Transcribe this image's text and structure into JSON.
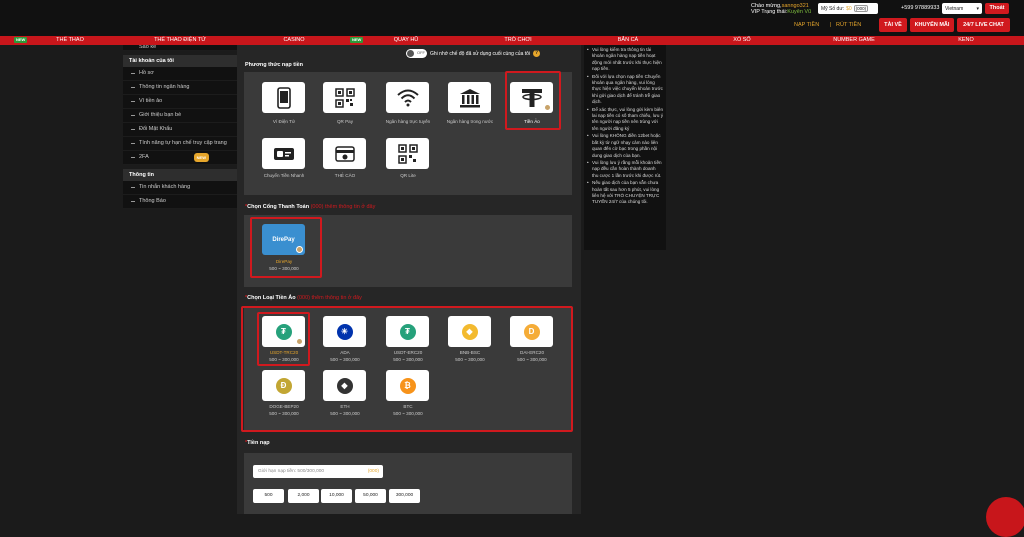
{
  "header": {
    "greeting_prefix": "Chào mừng,",
    "username": "sanngo321",
    "vip_prefix": "VIP Trạng thái:",
    "vip_level": "Kuyên Vũ",
    "wallet_label": "Mỹ Số dư:",
    "wallet_value": "$0",
    "wallet_currency": "(000)",
    "phone": "+599 97889933",
    "language": "Vietnam",
    "logout": "Thoát",
    "deposit_link": "NẠP TIỀN",
    "withdraw_link": "RÚT TIỀN",
    "separator": "|",
    "btn_wallet": "TÀI VỀ",
    "btn_promo": "KHUYẾN MÃI",
    "btn_chat": "24/7 LIVE CHAT"
  },
  "nav": {
    "items": [
      "THỂ THAO",
      "THỂ THAO ĐIỆN TỬ",
      "CASINO",
      "QUAY HŨ",
      "TRÒ CHƠI",
      "BẮN CÁ",
      "XỔ SỐ",
      "NUMBER GAME",
      "KENO"
    ],
    "new_badge": "NEW"
  },
  "sidebar": {
    "top_item": "Sao kê",
    "account_title": "Tài khoản của tôi",
    "account_items": [
      "Hồ sơ",
      "Thông tin ngân hàng",
      "Ví tiền ảo",
      "Giới thiệu bạn bè",
      "Đổi Mật Khẩu",
      "Tính năng tự hạn chế truy cập trang",
      "2FA"
    ],
    "new_badge": "NEW",
    "info_title": "Thông tin",
    "info_items": [
      "Tin nhắn khách hàng",
      "Thông Báo"
    ]
  },
  "remember": {
    "toggle_text": "OFF",
    "label": "Ghi nhớ chế độ đã sử dụng cuối cùng của tôi",
    "help": "?"
  },
  "methods": {
    "title": "Phương thức nạp tiền",
    "items": [
      {
        "label": "Ví Điện Tử",
        "icon": "phone-icon"
      },
      {
        "label": "QR Pay",
        "icon": "qr-icon"
      },
      {
        "label": "Ngân hàng trực tuyến",
        "icon": "wifi-icon"
      },
      {
        "label": "Ngân hàng trong nước",
        "icon": "bank-icon"
      },
      {
        "label": "Tiền Ảo",
        "icon": "tether-icon"
      },
      {
        "label": "Chuyển Tiền Nhanh",
        "icon": "card-transfer-icon"
      },
      {
        "label": "THẺ CÀO",
        "icon": "scratch-card-icon"
      },
      {
        "label": "QR Lite",
        "icon": "qr-icon"
      }
    ],
    "selected": "Tiền Ảo"
  },
  "gateway": {
    "required": "*",
    "title": "Chọn Cổng Thanh Toán",
    "hint": "(000) thêm thông tin ở đây",
    "items": [
      {
        "name": "DirePay",
        "range": "500 ~ 300,000",
        "logo": "DirePay"
      }
    ]
  },
  "crypto": {
    "required": "*",
    "title": "Chọn Loại Tiền Ảo",
    "hint": "(000) thêm thông tin ở đây",
    "items": [
      {
        "name": "USDT-TRC20",
        "range": "500 ~ 300,000",
        "color": "#26a17b",
        "glyph": "₮"
      },
      {
        "name": "ADA",
        "range": "500 ~ 300,000",
        "color": "#0033ad",
        "glyph": "✳"
      },
      {
        "name": "USDT-ERC20",
        "range": "500 ~ 300,000",
        "color": "#26a17b",
        "glyph": "₮"
      },
      {
        "name": "BNB-BSC",
        "range": "500 ~ 300,000",
        "color": "#f3ba2f",
        "glyph": "◆"
      },
      {
        "name": "DAI-ERC20",
        "range": "500 ~ 300,000",
        "color": "#f5ac37",
        "glyph": "D"
      },
      {
        "name": "DOGE-BEP20",
        "range": "500 ~ 300,000",
        "color": "#c2a633",
        "glyph": "Đ"
      },
      {
        "name": "ETH",
        "range": "500 ~ 300,000",
        "color": "#333333",
        "glyph": "◆"
      },
      {
        "name": "BTC",
        "range": "500 ~ 300,000",
        "color": "#f7931a",
        "glyph": "₿"
      }
    ]
  },
  "amount": {
    "required": "*",
    "title": "Tiền nạp",
    "placeholder": "Giới hạn nạp tiền: 500/300,000",
    "suffix": "(000)",
    "quick": [
      "500",
      "2,000",
      "10,000",
      "50,000",
      "300,000"
    ]
  },
  "notes": {
    "items": [
      "Vui lòng kiểm tra thông tin tài khoản ngân hàng nạp tiền hoạt động mới nhất trước khi thực hiện nạp tiền.",
      "Đối với lựa chọn nạp tiền Chuyển khoản qua ngân hàng, vui lòng thực hiện việc chuyển khoản trước khi gửi giao dịch để tránh trễ giao dịch.",
      "Để xác thực, vui lòng gửi kèm biên lai nạp tiền có số tham chiếu, lưu ý tên người nạp tiền nên trùng với tên người đăng ký",
      "Vui lòng KHÔNG điền 12bet hoặc bất kỳ từ ngữ nhạy cảm nào liên quan đến cờ bạc trong phần nội dung giao dịch của bạn.",
      "Vui lòng lưu ý rằng mỗi khoản tiền nạp đều cần hoàn thành doanh thu cược 1 lần trước khi được rút.",
      "Nếu giao dịch của bạn vẫn chưa hoàn tất sau hơn 5 phút, vui lòng liên hệ với TRÒ CHUYỆN TRỰC TUYẾN 24/7 của chúng tôi."
    ]
  }
}
